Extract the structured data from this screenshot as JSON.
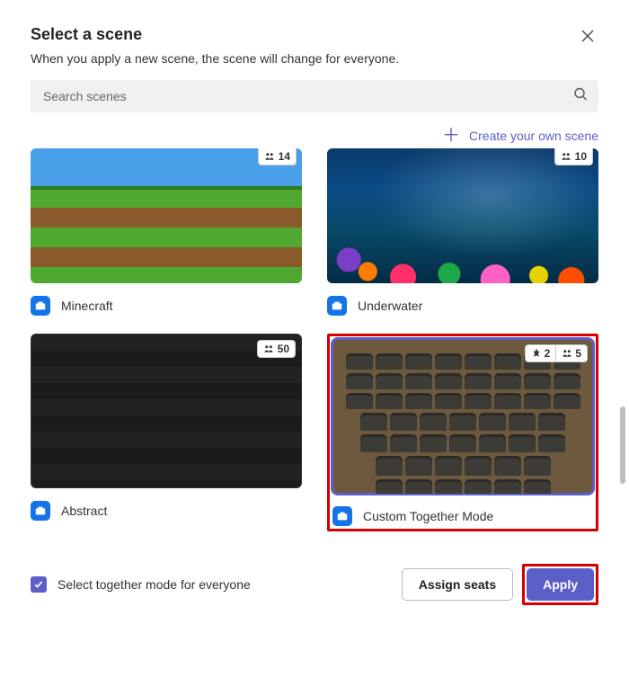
{
  "header": {
    "title": "Select a scene",
    "subtitle": "When you apply a new scene, the scene will change for everyone."
  },
  "search": {
    "placeholder": "Search scenes"
  },
  "create_link": "Create your own scene",
  "scenes": [
    {
      "label": "Minecraft",
      "seats": "14",
      "selected": false
    },
    {
      "label": "Underwater",
      "seats": "10",
      "selected": false
    },
    {
      "label": "Abstract",
      "seats": "50",
      "selected": false
    },
    {
      "label": "Custom Together Mode",
      "pins": "2",
      "seats": "5",
      "selected": true,
      "highlighted": true
    }
  ],
  "footer": {
    "checkbox_label": "Select together mode for everyone",
    "checked": true,
    "assign_seats": "Assign seats",
    "apply": "Apply",
    "apply_highlighted": true
  }
}
